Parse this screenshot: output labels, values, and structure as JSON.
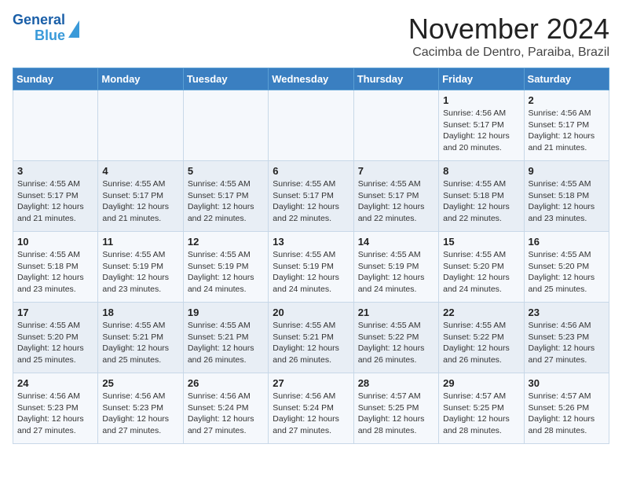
{
  "logo": {
    "line1": "General",
    "line2": "Blue"
  },
  "title": "November 2024",
  "location": "Cacimba de Dentro, Paraiba, Brazil",
  "days_header": [
    "Sunday",
    "Monday",
    "Tuesday",
    "Wednesday",
    "Thursday",
    "Friday",
    "Saturday"
  ],
  "weeks": [
    [
      {
        "day": "",
        "info": ""
      },
      {
        "day": "",
        "info": ""
      },
      {
        "day": "",
        "info": ""
      },
      {
        "day": "",
        "info": ""
      },
      {
        "day": "",
        "info": ""
      },
      {
        "day": "1",
        "info": "Sunrise: 4:56 AM\nSunset: 5:17 PM\nDaylight: 12 hours and 20 minutes."
      },
      {
        "day": "2",
        "info": "Sunrise: 4:56 AM\nSunset: 5:17 PM\nDaylight: 12 hours and 21 minutes."
      }
    ],
    [
      {
        "day": "3",
        "info": "Sunrise: 4:55 AM\nSunset: 5:17 PM\nDaylight: 12 hours and 21 minutes."
      },
      {
        "day": "4",
        "info": "Sunrise: 4:55 AM\nSunset: 5:17 PM\nDaylight: 12 hours and 21 minutes."
      },
      {
        "day": "5",
        "info": "Sunrise: 4:55 AM\nSunset: 5:17 PM\nDaylight: 12 hours and 22 minutes."
      },
      {
        "day": "6",
        "info": "Sunrise: 4:55 AM\nSunset: 5:17 PM\nDaylight: 12 hours and 22 minutes."
      },
      {
        "day": "7",
        "info": "Sunrise: 4:55 AM\nSunset: 5:17 PM\nDaylight: 12 hours and 22 minutes."
      },
      {
        "day": "8",
        "info": "Sunrise: 4:55 AM\nSunset: 5:18 PM\nDaylight: 12 hours and 22 minutes."
      },
      {
        "day": "9",
        "info": "Sunrise: 4:55 AM\nSunset: 5:18 PM\nDaylight: 12 hours and 23 minutes."
      }
    ],
    [
      {
        "day": "10",
        "info": "Sunrise: 4:55 AM\nSunset: 5:18 PM\nDaylight: 12 hours and 23 minutes."
      },
      {
        "day": "11",
        "info": "Sunrise: 4:55 AM\nSunset: 5:19 PM\nDaylight: 12 hours and 23 minutes."
      },
      {
        "day": "12",
        "info": "Sunrise: 4:55 AM\nSunset: 5:19 PM\nDaylight: 12 hours and 24 minutes."
      },
      {
        "day": "13",
        "info": "Sunrise: 4:55 AM\nSunset: 5:19 PM\nDaylight: 12 hours and 24 minutes."
      },
      {
        "day": "14",
        "info": "Sunrise: 4:55 AM\nSunset: 5:19 PM\nDaylight: 12 hours and 24 minutes."
      },
      {
        "day": "15",
        "info": "Sunrise: 4:55 AM\nSunset: 5:20 PM\nDaylight: 12 hours and 24 minutes."
      },
      {
        "day": "16",
        "info": "Sunrise: 4:55 AM\nSunset: 5:20 PM\nDaylight: 12 hours and 25 minutes."
      }
    ],
    [
      {
        "day": "17",
        "info": "Sunrise: 4:55 AM\nSunset: 5:20 PM\nDaylight: 12 hours and 25 minutes."
      },
      {
        "day": "18",
        "info": "Sunrise: 4:55 AM\nSunset: 5:21 PM\nDaylight: 12 hours and 25 minutes."
      },
      {
        "day": "19",
        "info": "Sunrise: 4:55 AM\nSunset: 5:21 PM\nDaylight: 12 hours and 26 minutes."
      },
      {
        "day": "20",
        "info": "Sunrise: 4:55 AM\nSunset: 5:21 PM\nDaylight: 12 hours and 26 minutes."
      },
      {
        "day": "21",
        "info": "Sunrise: 4:55 AM\nSunset: 5:22 PM\nDaylight: 12 hours and 26 minutes."
      },
      {
        "day": "22",
        "info": "Sunrise: 4:55 AM\nSunset: 5:22 PM\nDaylight: 12 hours and 26 minutes."
      },
      {
        "day": "23",
        "info": "Sunrise: 4:56 AM\nSunset: 5:23 PM\nDaylight: 12 hours and 27 minutes."
      }
    ],
    [
      {
        "day": "24",
        "info": "Sunrise: 4:56 AM\nSunset: 5:23 PM\nDaylight: 12 hours and 27 minutes."
      },
      {
        "day": "25",
        "info": "Sunrise: 4:56 AM\nSunset: 5:23 PM\nDaylight: 12 hours and 27 minutes."
      },
      {
        "day": "26",
        "info": "Sunrise: 4:56 AM\nSunset: 5:24 PM\nDaylight: 12 hours and 27 minutes."
      },
      {
        "day": "27",
        "info": "Sunrise: 4:56 AM\nSunset: 5:24 PM\nDaylight: 12 hours and 27 minutes."
      },
      {
        "day": "28",
        "info": "Sunrise: 4:57 AM\nSunset: 5:25 PM\nDaylight: 12 hours and 28 minutes."
      },
      {
        "day": "29",
        "info": "Sunrise: 4:57 AM\nSunset: 5:25 PM\nDaylight: 12 hours and 28 minutes."
      },
      {
        "day": "30",
        "info": "Sunrise: 4:57 AM\nSunset: 5:26 PM\nDaylight: 12 hours and 28 minutes."
      }
    ]
  ]
}
